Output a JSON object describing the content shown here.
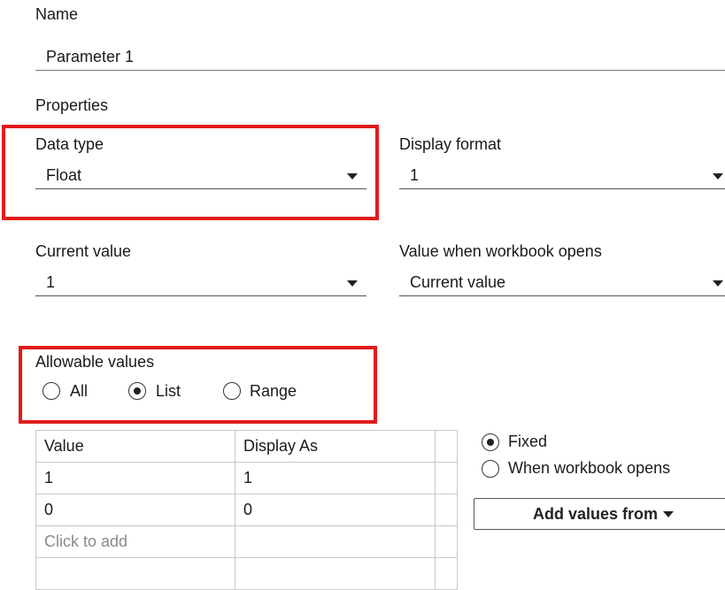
{
  "name_section": {
    "label": "Name",
    "value": "Parameter 1"
  },
  "properties": {
    "heading": "Properties",
    "data_type": {
      "label": "Data type",
      "value": "Float"
    },
    "display_format": {
      "label": "Display format",
      "value": "1"
    },
    "current_value": {
      "label": "Current value",
      "value": "1"
    },
    "value_when_opens": {
      "label": "Value when workbook opens",
      "value": "Current value"
    }
  },
  "allowable_values": {
    "label": "Allowable values",
    "options": [
      {
        "label": "All",
        "checked": false
      },
      {
        "label": "List",
        "checked": true
      },
      {
        "label": "Range",
        "checked": false
      }
    ]
  },
  "list_table": {
    "headers": [
      "Value",
      "Display As"
    ],
    "rows": [
      [
        "1",
        "1"
      ],
      [
        "0",
        "0"
      ]
    ],
    "add_row_placeholder": "Click to add"
  },
  "list_mode": {
    "options": [
      {
        "label": "Fixed",
        "checked": true
      },
      {
        "label": "When workbook opens",
        "checked": false
      }
    ]
  },
  "add_values_button": {
    "label": "Add values from"
  },
  "colors": {
    "highlight": "#e21b1b"
  }
}
